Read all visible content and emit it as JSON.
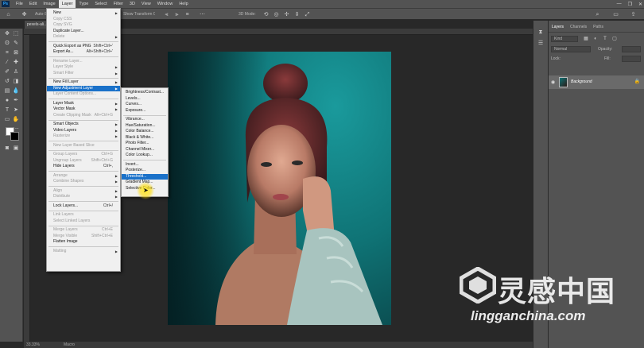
{
  "app": {
    "logo": "Ps",
    "colors": {
      "highlight": "#1a71c9",
      "menu_bg": "#f0f0f0",
      "ui_bg": "#535353",
      "photo_bg": "#0f7375"
    }
  },
  "menubar": {
    "items": [
      "File",
      "Edit",
      "Image",
      "Layer",
      "Type",
      "Select",
      "Filter",
      "3D",
      "View",
      "Window",
      "Help"
    ],
    "active": "Layer",
    "window_controls": [
      "—",
      "❐",
      "✕"
    ]
  },
  "options": {
    "autoselect_text": "Auto-Select:",
    "transform_text": "Show Transform Controls",
    "mode_text": "3D Mode:"
  },
  "document": {
    "tab_title": "pexels-ali..."
  },
  "status": {
    "zoom": "33.33%",
    "info": "Macro"
  },
  "layer_menu": {
    "items": [
      {
        "label": "New",
        "shortcut": "",
        "submenu": true,
        "disabled": false
      },
      {
        "label": "Copy CSS",
        "shortcut": "",
        "submenu": false,
        "disabled": true
      },
      {
        "label": "Copy SVG",
        "shortcut": "",
        "submenu": false,
        "disabled": true
      },
      {
        "label": "Duplicate Layer...",
        "shortcut": "",
        "submenu": false,
        "disabled": false
      },
      {
        "label": "Delete",
        "shortcut": "",
        "submenu": true,
        "disabled": true
      },
      {
        "label": "Quick Export as PNG",
        "shortcut": "Shift+Ctrl+'",
        "submenu": false,
        "disabled": false
      },
      {
        "label": "Export As...",
        "shortcut": "Alt+Shift+Ctrl+'",
        "submenu": false,
        "disabled": false
      },
      {
        "label": "Rename Layer...",
        "shortcut": "",
        "submenu": false,
        "disabled": true
      },
      {
        "label": "Layer Style",
        "shortcut": "",
        "submenu": true,
        "disabled": true
      },
      {
        "label": "Smart Filter",
        "shortcut": "",
        "submenu": true,
        "disabled": true
      },
      {
        "label": "New Fill Layer",
        "shortcut": "",
        "submenu": true,
        "disabled": false
      },
      {
        "label": "New Adjustment Layer",
        "shortcut": "",
        "submenu": true,
        "disabled": false
      },
      {
        "label": "Layer Content Options...",
        "shortcut": "",
        "submenu": false,
        "disabled": true
      },
      {
        "label": "Layer Mask",
        "shortcut": "",
        "submenu": true,
        "disabled": false
      },
      {
        "label": "Vector Mask",
        "shortcut": "",
        "submenu": true,
        "disabled": false
      },
      {
        "label": "Create Clipping Mask",
        "shortcut": "Alt+Ctrl+G",
        "submenu": false,
        "disabled": true
      },
      {
        "label": "Smart Objects",
        "shortcut": "",
        "submenu": true,
        "disabled": false
      },
      {
        "label": "Video Layers",
        "shortcut": "",
        "submenu": true,
        "disabled": false
      },
      {
        "label": "Rasterize",
        "shortcut": "",
        "submenu": true,
        "disabled": true
      },
      {
        "label": "New Layer Based Slice",
        "shortcut": "",
        "submenu": false,
        "disabled": true
      },
      {
        "label": "Group Layers",
        "shortcut": "Ctrl+G",
        "submenu": false,
        "disabled": true
      },
      {
        "label": "Ungroup Layers",
        "shortcut": "Shift+Ctrl+G",
        "submenu": false,
        "disabled": true
      },
      {
        "label": "Hide Layers",
        "shortcut": "Ctrl+,",
        "submenu": false,
        "disabled": false
      },
      {
        "label": "Arrange",
        "shortcut": "",
        "submenu": true,
        "disabled": true
      },
      {
        "label": "Combine Shapes",
        "shortcut": "",
        "submenu": true,
        "disabled": true
      },
      {
        "label": "Align",
        "shortcut": "",
        "submenu": true,
        "disabled": true
      },
      {
        "label": "Distribute",
        "shortcut": "",
        "submenu": true,
        "disabled": true
      },
      {
        "label": "Lock Layers...",
        "shortcut": "Ctrl+/",
        "submenu": false,
        "disabled": false
      },
      {
        "label": "Link Layers",
        "shortcut": "",
        "submenu": false,
        "disabled": true
      },
      {
        "label": "Select Linked Layers",
        "shortcut": "",
        "submenu": false,
        "disabled": true
      },
      {
        "label": "Merge Layers",
        "shortcut": "Ctrl+E",
        "submenu": false,
        "disabled": true
      },
      {
        "label": "Merge Visible",
        "shortcut": "Shift+Ctrl+E",
        "submenu": false,
        "disabled": true
      },
      {
        "label": "Flatten Image",
        "shortcut": "",
        "submenu": false,
        "disabled": false
      },
      {
        "label": "Matting",
        "shortcut": "",
        "submenu": true,
        "disabled": true
      }
    ]
  },
  "adjustment_menu": {
    "items": [
      {
        "label": "Brightness/Contrast..."
      },
      {
        "label": "Levels..."
      },
      {
        "label": "Curves..."
      },
      {
        "label": "Exposure..."
      },
      {
        "label": "Vibrance..."
      },
      {
        "label": "Hue/Saturation..."
      },
      {
        "label": "Color Balance..."
      },
      {
        "label": "Black & White..."
      },
      {
        "label": "Photo Filter..."
      },
      {
        "label": "Channel Mixer..."
      },
      {
        "label": "Color Lookup..."
      },
      {
        "label": "Invert..."
      },
      {
        "label": "Posterize..."
      },
      {
        "label": "Threshold..."
      },
      {
        "label": "Gradient Map..."
      },
      {
        "label": "Selective Color..."
      }
    ],
    "highlighted": "Threshold..."
  },
  "layers_panel": {
    "tabs": [
      "Layers",
      "Channels",
      "Paths"
    ],
    "kind_placeholder": "Kind",
    "blend_mode": "Normal",
    "opacity_label": "Opacity:",
    "lock_label": "Lock:",
    "fill_label": "Fill:",
    "layer_name": "Background"
  },
  "watermark": {
    "cn": "灵感中国",
    "url": "lingganchina.com"
  }
}
